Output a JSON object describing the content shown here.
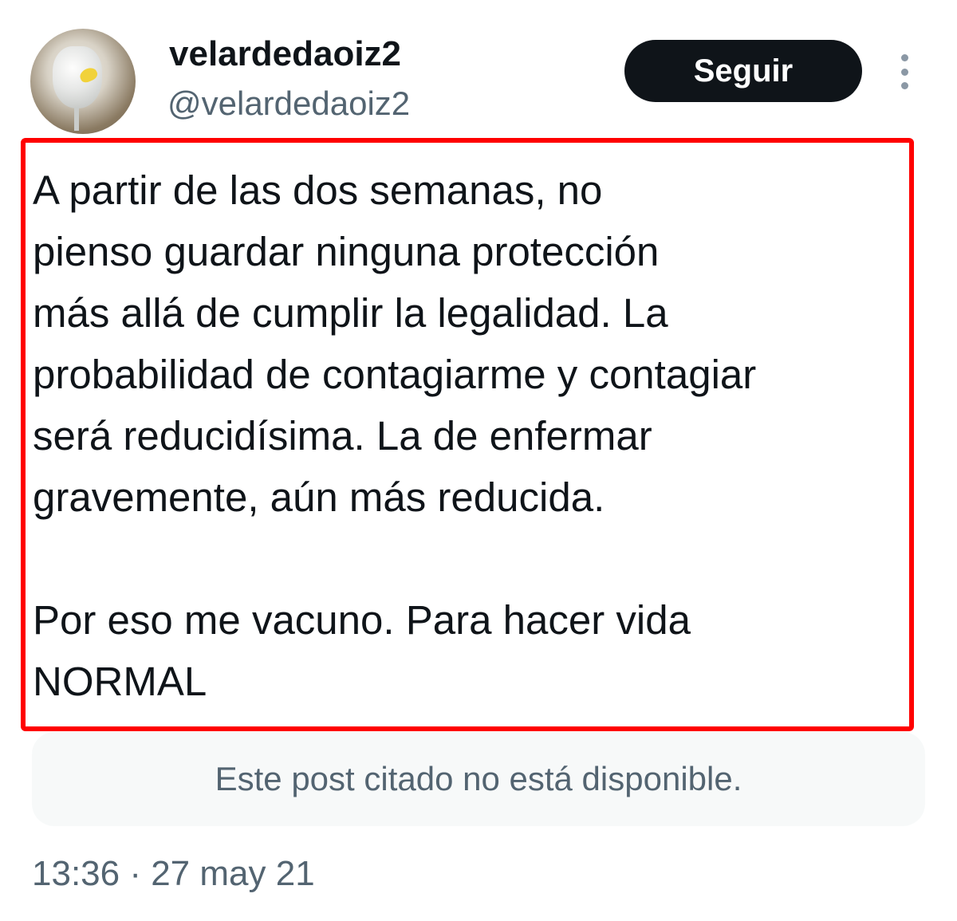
{
  "author": {
    "display_name": "velardedaoiz2",
    "handle": "@velardedaoiz2",
    "avatar_icon": "glass-with-lemon-avatar"
  },
  "actions": {
    "follow_label": "Seguir",
    "more_icon": "more-vertical-icon"
  },
  "tweet": {
    "paragraph_1": "A partir de las dos semanas, no\npienso guardar ninguna protección\nmás allá de cumplir la legalidad. La\nprobabilidad de contagiarme y contagiar\nserá reducidísima. La de enfermar\ngravemente, aún más reducida.",
    "paragraph_2": "Por eso me vacuno. Para hacer vida\nNORMAL",
    "highlight_color": "#ff0000"
  },
  "quoted_post": {
    "message": "Este post citado no está disponible."
  },
  "meta": {
    "timestamp": "13:36 · 27 may 21"
  }
}
